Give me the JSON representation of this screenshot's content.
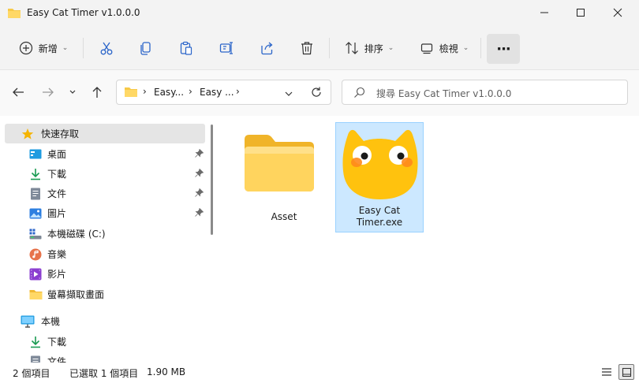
{
  "window": {
    "title": "Easy Cat Timer v1.0.0.0",
    "minimize_icon": "minimize-icon",
    "maximize_icon": "maximize-icon",
    "close_icon": "close-icon"
  },
  "toolbar": {
    "new_label": "新增",
    "sort_label": "排序",
    "view_label": "檢視",
    "more_label": "···",
    "icons": [
      "new-icon",
      "cut-icon",
      "copy-icon",
      "paste-icon",
      "rename-icon",
      "share-icon",
      "delete-icon",
      "sort-icon",
      "view-icon",
      "more-icon"
    ]
  },
  "nav": {
    "breadcrumb": [
      "Easy...",
      "Easy ..."
    ],
    "search_placeholder": "搜尋 Easy Cat Timer v1.0.0.0"
  },
  "sidebar": {
    "quick_access": "快速存取",
    "items": [
      {
        "label": "桌面",
        "icon": "desktop-icon",
        "pinned": true
      },
      {
        "label": "下載",
        "icon": "download-icon",
        "pinned": true
      },
      {
        "label": "文件",
        "icon": "document-icon",
        "pinned": true
      },
      {
        "label": "圖片",
        "icon": "picture-icon",
        "pinned": true
      },
      {
        "label": "本機磁碟 (C:)",
        "icon": "drive-icon",
        "pinned": false
      },
      {
        "label": "音樂",
        "icon": "music-icon",
        "pinned": false
      },
      {
        "label": "影片",
        "icon": "video-icon",
        "pinned": false
      },
      {
        "label": "螢幕擷取畫面",
        "icon": "folder-icon",
        "pinned": false
      }
    ],
    "this_pc": "本機",
    "pc_items": [
      {
        "label": "下載",
        "icon": "download-icon"
      },
      {
        "label": "文件",
        "icon": "document-icon"
      }
    ]
  },
  "files": [
    {
      "name": "Asset",
      "type": "folder",
      "selected": false
    },
    {
      "name_line1": "Easy Cat",
      "name_line2": "Timer.exe",
      "type": "exe",
      "selected": true
    }
  ],
  "status": {
    "count": "2 個項目",
    "selected": "已選取 1 個項目",
    "size": "1.90 MB"
  },
  "colors": {
    "selection_bg": "#cce8ff",
    "selection_border": "#99d1ff",
    "folder_yellow": "#f7c948",
    "cat_yellow": "#ffc20e"
  }
}
